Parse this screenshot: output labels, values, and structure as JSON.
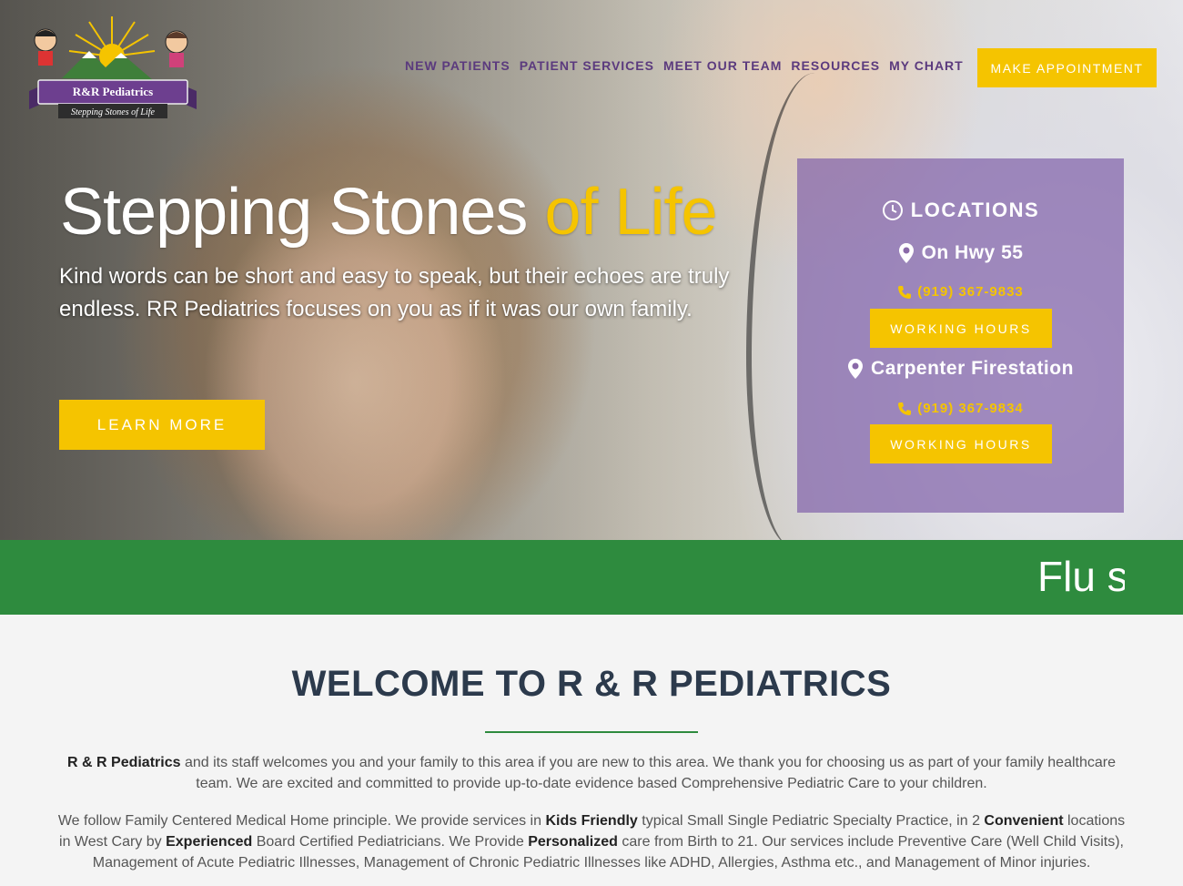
{
  "header": {
    "logo": {
      "name": "R&R Pediatrics",
      "tagline": "Stepping Stones of Life"
    },
    "nav": [
      "NEW PATIENTS",
      "PATIENT SERVICES",
      "MEET OUR TEAM",
      "RESOURCES",
      "MY CHART"
    ],
    "cta_label": "MAKE APPOINTMENT"
  },
  "hero": {
    "title_main": "Stepping Stones",
    "title_accent": "of Life",
    "subtitle": "Kind words can be short and easy to speak, but their echoes are truly endless. RR Pediatrics focuses on you as if it was our own family.",
    "button_label": "LEARN MORE"
  },
  "locations": {
    "title": "LOCATIONS",
    "items": [
      {
        "name": "On Hwy 55",
        "phone": "(919) 367-9833",
        "button_label": "WORKING HOURS"
      },
      {
        "name": "Carpenter Firestation",
        "phone": "(919) 367-9834",
        "button_label": "WORKING HOURS"
      }
    ]
  },
  "banner": {
    "ticker_text": "Flu s"
  },
  "welcome": {
    "title": "WELCOME TO R & R PEDIATRICS",
    "p1_bold": "R & R Pediatrics",
    "p1_text": " and its staff welcomes you and your family to this area if you are new to this area. We thank you for choosing us as part of your family healthcare team. We are excited and committed to provide up-to-date evidence based Comprehensive Pediatric Care to your children.",
    "p2_a": "We follow Family Centered Medical Home principle. We provide services in ",
    "p2_b": "Kids Friendly",
    "p2_c": " typical Small Single Pediatric Specialty Practice, in 2 ",
    "p2_d": "Convenient",
    "p2_e": " locations in West Cary by ",
    "p2_f": "Experienced",
    "p2_g": " Board Certified Pediatricians. We Provide ",
    "p2_h": "Personalized",
    "p2_i": " care from Birth to 21. Our services include Preventive Care (Well Child Visits), Management of Acute Pediatric Illnesses, Management of Chronic Pediatric Illnesses like ADHD, Allergies, Asthma etc., and Management of Minor injuries."
  },
  "colors": {
    "accent_yellow": "#f5c400",
    "nav_purple": "#5b3a7e",
    "band_green": "#2e8b3e",
    "title_navy": "#2c3a4c"
  },
  "icons": [
    "clock-icon",
    "map-pin-icon",
    "phone-icon",
    "sun-icon"
  ]
}
